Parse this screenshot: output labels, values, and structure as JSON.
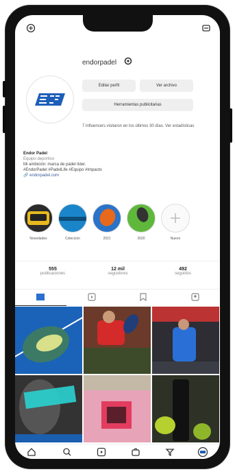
{
  "profile": {
    "username": "endorpadel",
    "name": "Endor Padel",
    "category": "Equipo deportivo",
    "bio_lines": [
      "Mi ambición: marca de pádel líder.",
      "#EndorPadel #PadelLife #Equipo #Impacto"
    ],
    "link": "endorpadel.com"
  },
  "buttons": {
    "edit_profile": "Editar perfil",
    "view_archive": "Ver archivo",
    "ad_tools": "Herramientas publicitarias"
  },
  "summary": "7 influencers visitaron en los últimos 30 días. Ver estadísticas",
  "highlights": [
    {
      "label": "Novedades"
    },
    {
      "label": "Colección"
    },
    {
      "label": "2021"
    },
    {
      "label": "2020"
    },
    {
      "label": "Nuevo"
    }
  ],
  "stats": [
    {
      "value": "555",
      "label": "publicaciones"
    },
    {
      "value": "12 mil",
      "label": "seguidores"
    },
    {
      "value": "492",
      "label": "seguidos"
    }
  ],
  "colors": {
    "accent": "#2a6fcf",
    "logo_blue": "#1d5fb8",
    "frame": "#111111"
  },
  "icons": {
    "top_left": "circle-add-icon",
    "top_right": "menu-icon",
    "bottom": [
      "home-icon",
      "search-icon",
      "reels-icon",
      "shop-icon",
      "activity-icon",
      "profile-icon"
    ]
  }
}
